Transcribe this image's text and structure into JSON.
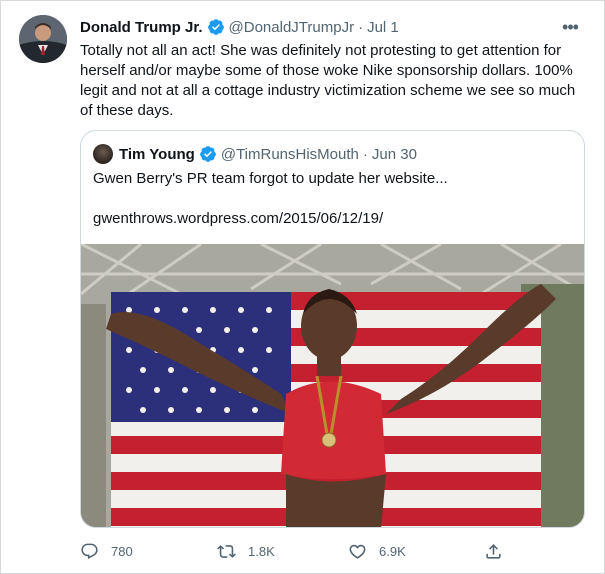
{
  "tweet": {
    "author_name": "Donald Trump Jr.",
    "handle": "@DonaldJTrumpJr",
    "separator": "·",
    "date": "Jul 1",
    "more_label": "•••",
    "text": "Totally not all an act! She was definitely not protesting to get attention for herself and/or maybe some of those woke Nike sponsorship dollars. 100% legit and not at all a cottage industry victimization scheme we see so much of these days."
  },
  "quote": {
    "author_name": "Tim Young",
    "handle": "@TimRunsHisMouth",
    "separator": "·",
    "date": "Jun 30",
    "text": "Gwen Berry's PR team forgot to update her website...",
    "link": "gwenthrows.wordpress.com/2015/06/12/19/"
  },
  "actions": {
    "replies": "780",
    "retweets": "1.8K",
    "likes": "6.9K"
  },
  "colors": {
    "verified": "#1d9bf0",
    "secondary_text": "#536471",
    "border": "#cfd9de"
  },
  "icons": {
    "verified": "verified-badge-icon",
    "reply": "reply-icon",
    "retweet": "retweet-icon",
    "like": "heart-icon",
    "share": "share-icon",
    "more": "more-icon"
  }
}
